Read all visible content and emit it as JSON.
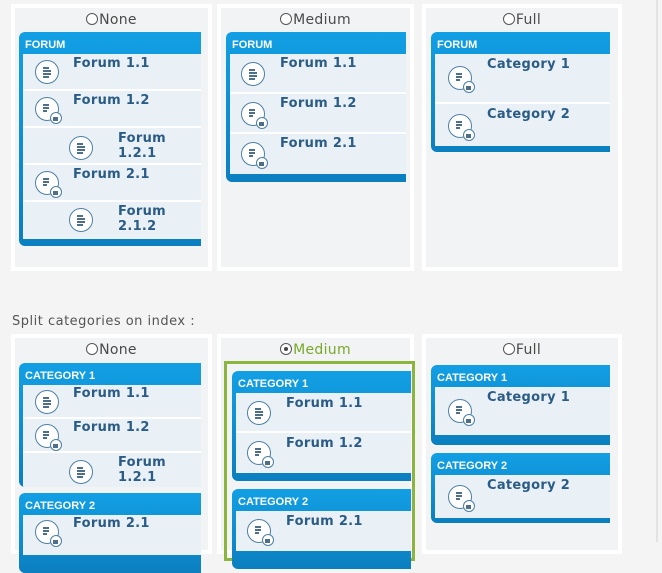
{
  "forum_layout": {
    "options": [
      {
        "label": "None",
        "selected": false,
        "categories": [
          {
            "header": "FORUM",
            "rows": [
              {
                "label": "Forum 1.1",
                "icon": "forum-icon",
                "indent": false
              },
              {
                "label": "Forum 1.2",
                "icon": "forum-subforums-icon",
                "indent": false
              },
              {
                "label": "Forum 1.2.1",
                "icon": "forum-icon",
                "indent": true
              },
              {
                "label": "Forum 2.1",
                "icon": "forum-subforums-icon",
                "indent": false
              },
              {
                "label": "Forum 2.1.2",
                "icon": "forum-icon",
                "indent": true
              }
            ]
          }
        ]
      },
      {
        "label": "Medium",
        "selected": false,
        "categories": [
          {
            "header": "FORUM",
            "rows": [
              {
                "label": "Forum 1.1",
                "icon": "forum-icon"
              },
              {
                "label": "Forum 1.2",
                "icon": "forum-subforums-icon"
              },
              {
                "label": "Forum 2.1",
                "icon": "forum-subforums-icon"
              }
            ]
          }
        ]
      },
      {
        "label": "Full",
        "selected": false,
        "categories": [
          {
            "header": "FORUM",
            "rows": [
              {
                "label": "Category 1",
                "icon": "forum-subforums-icon"
              },
              {
                "label": "Category 2",
                "icon": "forum-subforums-icon"
              }
            ]
          }
        ]
      }
    ]
  },
  "split_categories": {
    "label": "Split categories on index :",
    "options": [
      {
        "label": "None",
        "selected": false,
        "categories": [
          {
            "header": "CATEGORY 1",
            "rows": [
              {
                "label": "Forum 1.1",
                "icon": "forum-icon",
                "indent": false
              },
              {
                "label": "Forum 1.2",
                "icon": "forum-subforums-icon",
                "indent": false
              },
              {
                "label": "Forum 1.2.1",
                "icon": "forum-icon",
                "indent": true
              }
            ]
          },
          {
            "header": "CATEGORY 2",
            "rows": [
              {
                "label": "Forum 2.1",
                "icon": "forum-subforums-icon",
                "indent": false
              }
            ]
          }
        ]
      },
      {
        "label": "Medium",
        "selected": true,
        "categories": [
          {
            "header": "CATEGORY 1",
            "rows": [
              {
                "label": "Forum 1.1",
                "icon": "forum-icon"
              },
              {
                "label": "Forum 1.2",
                "icon": "forum-subforums-icon"
              }
            ]
          },
          {
            "header": "CATEGORY 2",
            "rows": [
              {
                "label": "Forum 2.1",
                "icon": "forum-subforums-icon"
              }
            ]
          }
        ]
      },
      {
        "label": "Full",
        "selected": false,
        "categories": [
          {
            "header": "CATEGORY 1",
            "rows": [
              {
                "label": "Category 1",
                "icon": "forum-subforums-icon"
              }
            ]
          },
          {
            "header": "CATEGORY 2",
            "rows": [
              {
                "label": "Category 2",
                "icon": "forum-subforums-icon"
              }
            ]
          }
        ]
      }
    ]
  },
  "colors": {
    "accent_selected": "#8bb53c",
    "category_header": "#129fe4",
    "forum_text": "#2a5c86"
  }
}
